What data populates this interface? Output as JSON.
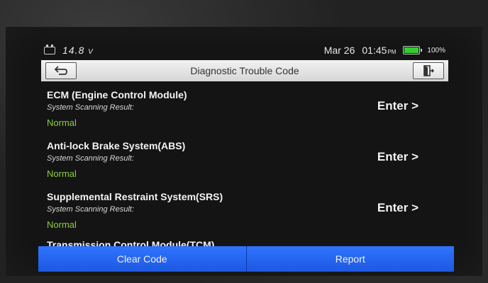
{
  "status": {
    "voltage": "14.8",
    "voltage_unit": "V",
    "date": "Mar 26",
    "time": "01:45",
    "ampm": "PM",
    "battery_pct": "100%",
    "battery_level": 1.0
  },
  "header": {
    "title": "Diagnostic Trouble Code"
  },
  "systems": [
    {
      "name": "ECM (Engine Control Module)",
      "result_label": "System Scanning Result:",
      "result": "Normal",
      "action": "Enter >"
    },
    {
      "name": "Anti-lock Brake System(ABS)",
      "result_label": "System Scanning Result:",
      "result": "Normal",
      "action": "Enter >"
    },
    {
      "name": "Supplemental Restraint System(SRS)",
      "result_label": "System Scanning Result:",
      "result": "Normal",
      "action": "Enter >"
    },
    {
      "name": "Transmission Control Module(TCM)"
    }
  ],
  "footer": {
    "clear_label": "Clear Code",
    "report_label": "Report"
  },
  "colors": {
    "result_normal": "#8ccf3c",
    "button_blue": "#2f74ff"
  }
}
